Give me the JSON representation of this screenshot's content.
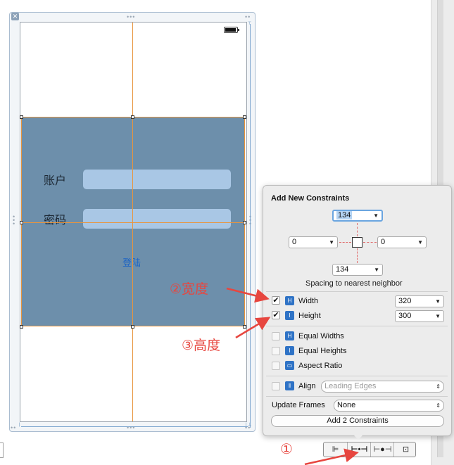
{
  "login_form": {
    "account_label": "账户",
    "password_label": "密码",
    "login_button": "登陆"
  },
  "popover": {
    "title": "Add New Constraints",
    "top_value": "134",
    "left_value": "0",
    "right_value": "0",
    "bottom_value": "134",
    "spacing_caption": "Spacing to nearest neighbor",
    "rows": [
      {
        "label": "Width",
        "value": "320",
        "checked": true
      },
      {
        "label": "Height",
        "value": "300",
        "checked": true
      },
      {
        "label": "Equal Widths",
        "checked": false
      },
      {
        "label": "Equal Heights",
        "checked": false
      },
      {
        "label": "Aspect Ratio",
        "checked": false
      }
    ],
    "align_label": "Align",
    "align_value": "Leading Edges",
    "update_frames_label": "Update Frames",
    "update_frames_value": "None",
    "add_button": "Add 2 Constraints"
  },
  "annotations": {
    "step1": "①",
    "step2": "②宽度",
    "step3": "③高度"
  },
  "colors": {
    "panel": "#6d8fab",
    "guide": "#e8953e",
    "annotation": "#e7463f",
    "accent": "#2f73c6"
  }
}
